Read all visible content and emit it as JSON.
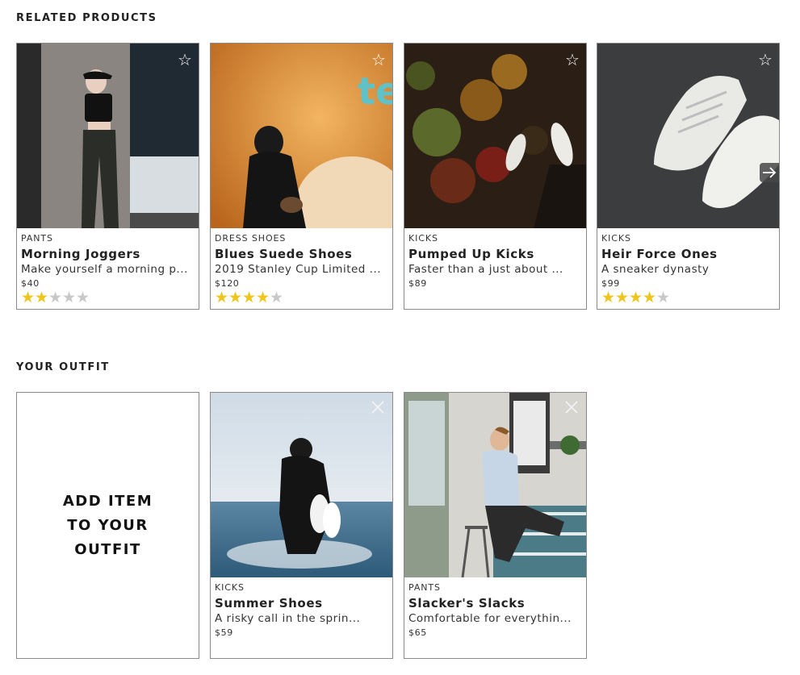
{
  "related": {
    "title": "RELATED PRODUCTS",
    "products": [
      {
        "category": "PANTS",
        "name": "Morning Joggers",
        "description": "Make yourself a morning p...",
        "price": "$40",
        "rating": 2,
        "fav_icon": "star-outline-icon"
      },
      {
        "category": "DRESS SHOES",
        "name": "Blues Suede Shoes",
        "description": "2019 Stanley Cup Limited ...",
        "price": "$120",
        "rating": 4,
        "fav_icon": "star-outline-icon"
      },
      {
        "category": "KICKS",
        "name": "Pumped Up Kicks",
        "description": "Faster than a just about ...",
        "price": "$89",
        "rating": null,
        "fav_icon": "star-outline-icon"
      },
      {
        "category": "KICKS",
        "name": "Heir Force Ones",
        "description": "A sneaker dynasty",
        "price": "$99",
        "rating": 4,
        "fav_icon": "star-outline-icon"
      }
    ],
    "next_icon": "arrow-right-icon"
  },
  "outfit": {
    "title": "YOUR OUTFIT",
    "add_label": "ADD ITEM TO YOUR OUTFIT",
    "items": [
      {
        "category": "KICKS",
        "name": "Summer Shoes",
        "description": "A risky call in the sprin...",
        "price": "$59",
        "remove_icon": "close-icon"
      },
      {
        "category": "PANTS",
        "name": "Slacker's Slacks",
        "description": "Comfortable for everythin...",
        "price": "$65",
        "remove_icon": "close-icon"
      }
    ]
  },
  "colors": {
    "star_filled": "#f0c419",
    "star_empty": "#c8c8c8",
    "border": "#8a8a8a"
  }
}
